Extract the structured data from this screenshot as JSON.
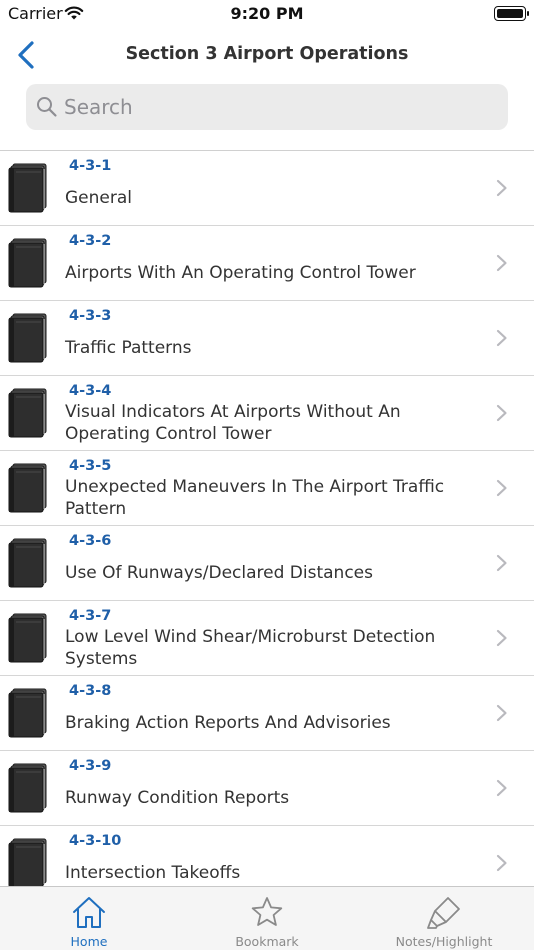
{
  "status_bar": {
    "carrier": "Carrier",
    "time": "9:20 PM"
  },
  "nav": {
    "title": "Section 3 Airport Operations",
    "back_icon": "chevron-left-icon"
  },
  "search": {
    "placeholder": "Search",
    "value": ""
  },
  "list": {
    "item_icon": "book-icon",
    "items": [
      {
        "number": "4-3-1",
        "title": "General"
      },
      {
        "number": "4-3-2",
        "title": "Airports With An Operating Control Tower"
      },
      {
        "number": "4-3-3",
        "title": "Traffic Patterns"
      },
      {
        "number": "4-3-4",
        "title": "Visual Indicators At Airports Without An Operating Control Tower"
      },
      {
        "number": "4-3-5",
        "title": "Unexpected Maneuvers In The Airport Traffic Pattern"
      },
      {
        "number": "4-3-6",
        "title": "Use Of Runways/Declared Distances"
      },
      {
        "number": "4-3-7",
        "title": "Low Level Wind Shear/Microburst Detection Systems"
      },
      {
        "number": "4-3-8",
        "title": "Braking Action Reports And Advisories"
      },
      {
        "number": "4-3-9",
        "title": "Runway Condition Reports"
      },
      {
        "number": "4-3-10",
        "title": "Intersection Takeoffs"
      }
    ]
  },
  "tabs": [
    {
      "label": "Home",
      "icon": "home-icon",
      "active": true
    },
    {
      "label": "Bookmark",
      "icon": "star-icon",
      "active": false
    },
    {
      "label": "Notes/Highlight",
      "icon": "highlighter-icon",
      "active": false
    }
  ],
  "colors": {
    "accent": "#1f6fbf",
    "section_number": "#1f5fa8",
    "search_bg": "#ebebeb",
    "tab_bar_bg": "#f5f5f5"
  }
}
